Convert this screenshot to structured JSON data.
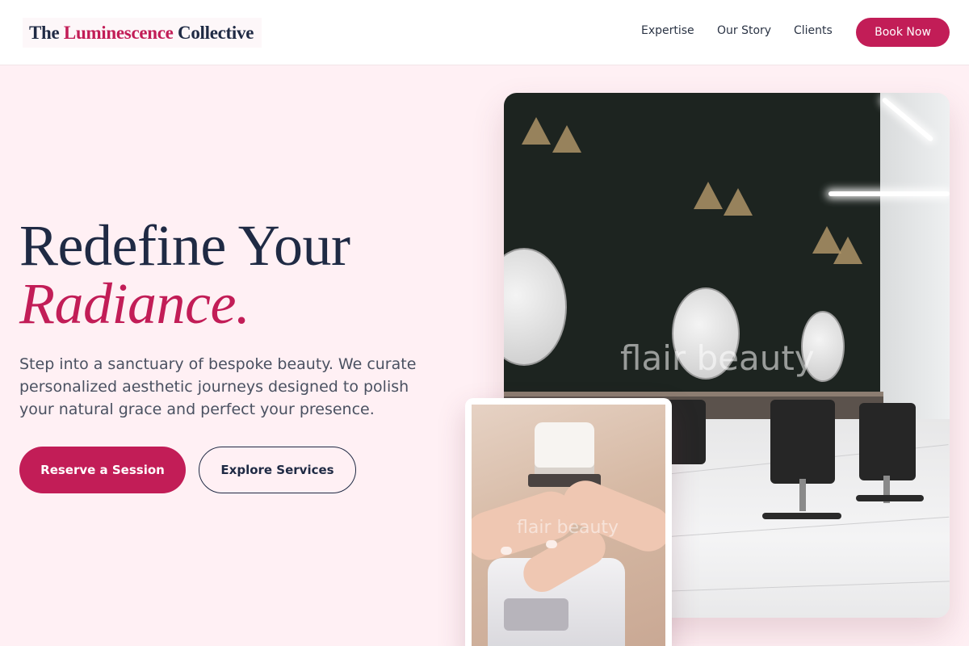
{
  "header": {
    "logo": {
      "part1": "The",
      "accent": "Luminescence",
      "part2": "Collective"
    },
    "nav": [
      {
        "label": "Expertise"
      },
      {
        "label": "Our Story"
      },
      {
        "label": "Clients"
      }
    ],
    "cta_label": "Book Now"
  },
  "hero": {
    "headline_line1": "Redefine Your",
    "headline_line2": "Radiance.",
    "description": "Step into a sanctuary of bespoke beauty. We curate personalized aesthetic journeys designed to polish your natural grace and perfect your presence.",
    "primary_button": "Reserve a Session",
    "secondary_button": "Explore Services"
  },
  "images": {
    "salon_watermark": "flair beauty",
    "nails_watermark": "flair beauty"
  },
  "colors": {
    "accent": "#c21d57",
    "navy": "#1f2a44",
    "background": "#fff0f4"
  }
}
